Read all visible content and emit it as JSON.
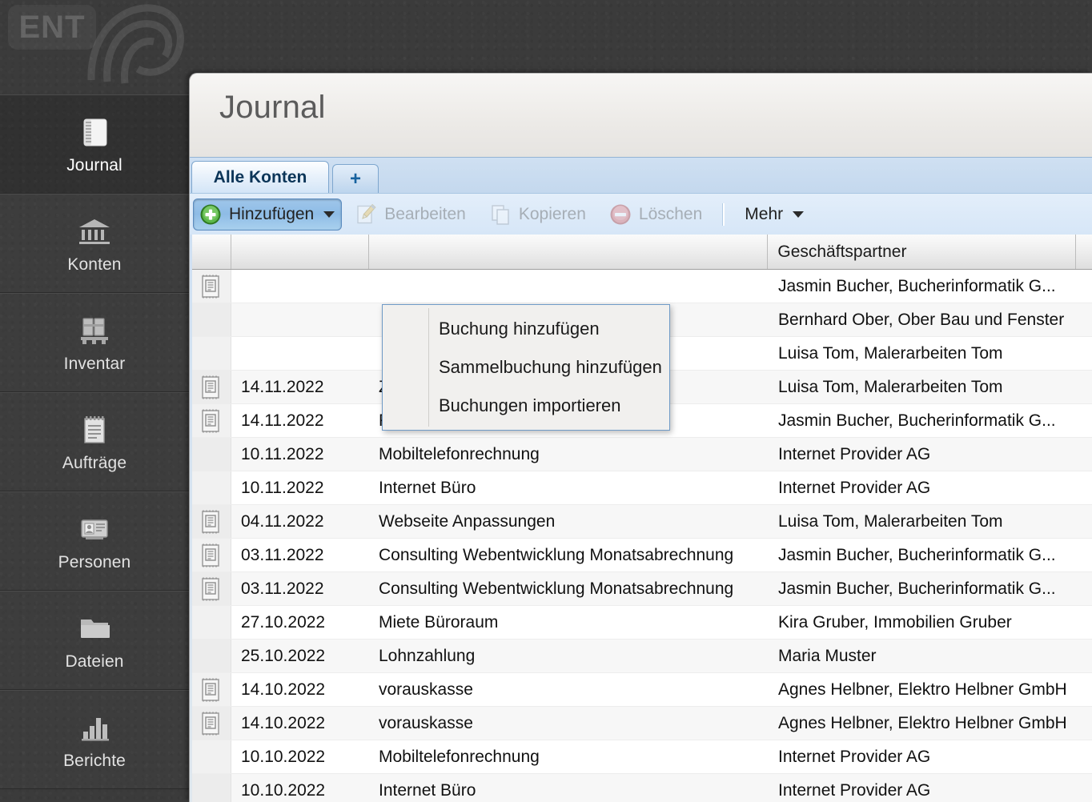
{
  "desktop": {
    "logo_text": "ENT"
  },
  "sidebar": {
    "items": [
      {
        "label": "Journal",
        "icon": "notebook-icon",
        "active": true
      },
      {
        "label": "Konten",
        "icon": "bank-icon",
        "active": false
      },
      {
        "label": "Inventar",
        "icon": "pallet-icon",
        "active": false
      },
      {
        "label": "Aufträge",
        "icon": "order-pad-icon",
        "active": false
      },
      {
        "label": "Personen",
        "icon": "id-card-icon",
        "active": false
      },
      {
        "label": "Dateien",
        "icon": "folder-icon",
        "active": false
      },
      {
        "label": "Berichte",
        "icon": "bar-chart-icon",
        "active": false
      }
    ]
  },
  "window": {
    "title": "Journal"
  },
  "tabs": [
    {
      "label": "Alle Konten",
      "selected": true,
      "name": "tab-alle-konten"
    },
    {
      "label": "+",
      "selected": false,
      "name": "tab-add"
    }
  ],
  "toolbar": {
    "add_label": "Hinzufügen",
    "edit_label": "Bearbeiten",
    "copy_label": "Kopieren",
    "delete_label": "Löschen",
    "more_label": "Mehr"
  },
  "menu": {
    "items": [
      "Buchung hinzufügen",
      "Sammelbuchung hinzufügen",
      "Buchungen importieren"
    ]
  },
  "table": {
    "headers": [
      "",
      "",
      "",
      "Geschäftspartner"
    ],
    "partner_header": "Geschäftspartner",
    "rows": [
      {
        "icon": "receipt-icon",
        "date": "",
        "desc": "",
        "partner": "Jasmin Bucher, Bucherinformatik G..."
      },
      {
        "icon": "",
        "date": "",
        "desc": "",
        "partner": "Bernhard Ober, Ober Bau und Fenster"
      },
      {
        "icon": "",
        "date": "",
        "desc": "",
        "partner": "Luisa Tom, Malerarbeiten Tom"
      },
      {
        "icon": "receipt-icon",
        "date": "14.11.2022",
        "desc": "Zahlung",
        "partner": "Luisa Tom, Malerarbeiten Tom"
      },
      {
        "icon": "receipt-icon",
        "date": "14.11.2022",
        "desc": "Payment",
        "partner": "Jasmin Bucher, Bucherinformatik G..."
      },
      {
        "icon": "",
        "date": "10.11.2022",
        "desc": "Mobiltelefonrechnung",
        "partner": "Internet Provider AG"
      },
      {
        "icon": "",
        "date": "10.11.2022",
        "desc": "Internet Büro",
        "partner": "Internet Provider AG"
      },
      {
        "icon": "receipt-icon",
        "date": "04.11.2022",
        "desc": "Webseite Anpassungen",
        "partner": "Luisa Tom, Malerarbeiten Tom"
      },
      {
        "icon": "receipt-icon",
        "date": "03.11.2022",
        "desc": "Consulting Webentwicklung Monatsabrechnung",
        "partner": "Jasmin Bucher, Bucherinformatik G..."
      },
      {
        "icon": "receipt-icon",
        "date": "03.11.2022",
        "desc": "Consulting Webentwicklung Monatsabrechnung",
        "partner": "Jasmin Bucher, Bucherinformatik G..."
      },
      {
        "icon": "",
        "date": "27.10.2022",
        "desc": "Miete Büroraum",
        "partner": "Kira Gruber, Immobilien Gruber"
      },
      {
        "icon": "",
        "date": "25.10.2022",
        "desc": "Lohnzahlung",
        "partner": "Maria Muster"
      },
      {
        "icon": "receipt-icon",
        "date": "14.10.2022",
        "desc": "vorauskasse",
        "partner": "Agnes Helbner, Elektro Helbner GmbH"
      },
      {
        "icon": "receipt-icon",
        "date": "14.10.2022",
        "desc": "vorauskasse",
        "partner": "Agnes Helbner, Elektro Helbner GmbH"
      },
      {
        "icon": "",
        "date": "10.10.2022",
        "desc": "Mobiltelefonrechnung",
        "partner": "Internet Provider AG"
      },
      {
        "icon": "",
        "date": "10.10.2022",
        "desc": "Internet Büro",
        "partner": "Internet Provider AG"
      }
    ]
  },
  "colors": {
    "desktop_bg": "#3b3b3b",
    "accent_blue": "#8ebce6",
    "tab_text": "#0b3558",
    "add_green": "#4fa63a",
    "delete_red": "#d0474a"
  }
}
